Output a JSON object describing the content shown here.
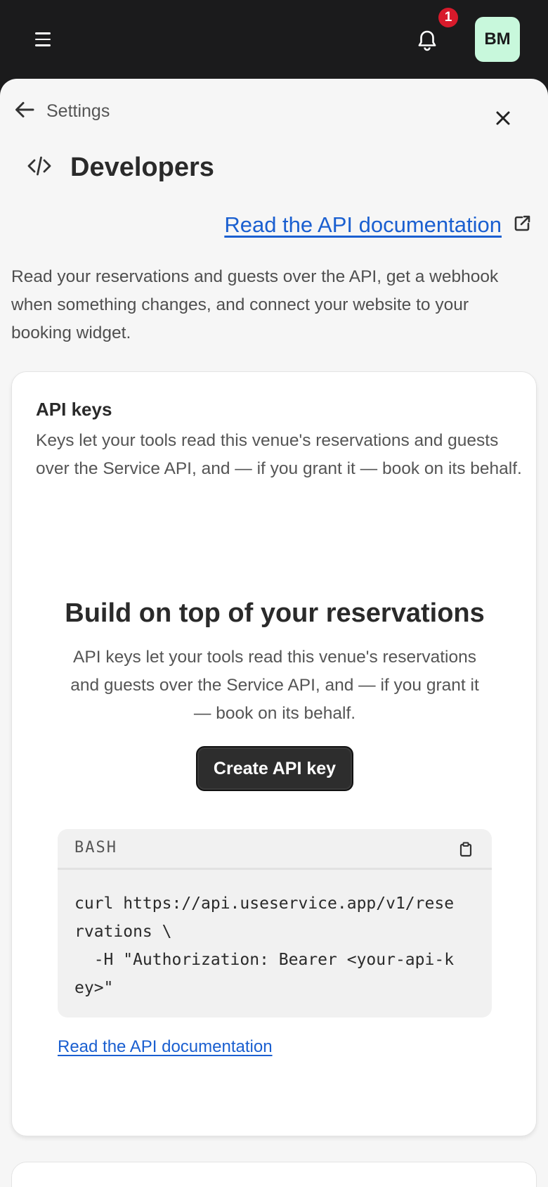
{
  "header": {
    "notification_count": "1",
    "avatar_initials": "BM",
    "colors": {
      "bar": "#1b1b1c",
      "badge": "#d81a2b",
      "avatar": "#c8f8dc"
    }
  },
  "panel": {
    "back_label": "Settings",
    "title": "Developers",
    "doc_link": "Read the API documentation",
    "intro": "Read your reservations and guests over the API, get a webhook when something changes, and connect your website to your booking widget."
  },
  "api_keys": {
    "title": "API keys",
    "description": "Keys let your tools read this venue's reservations and guests over the Service API, and — if you grant it — book on its behalf.",
    "empty_title": "Build on top of your reservations",
    "empty_description": "API keys let your tools read this venue's reservations and guests over the Service API, and — if you grant it — book on its behalf.",
    "create_button": "Create API key",
    "code_language": "BASH",
    "code_lines": [
      "curl https://api.useservice.app/v1/rese",
      "rvations \\",
      "  -H \"Authorization: Bearer <your-api-k",
      "ey>\""
    ],
    "doc_link": "Read the API documentation"
  },
  "icons": {
    "menu": "hamburger-icon",
    "bell": "bell-icon",
    "back": "arrow-left-icon",
    "close": "close-icon",
    "code": "code-icon",
    "external": "external-link-icon",
    "copy": "clipboard-icon"
  },
  "colors": {
    "link": "#1a5fd0",
    "sheet": "#f6f6f6",
    "button": "#2d2d2d"
  }
}
